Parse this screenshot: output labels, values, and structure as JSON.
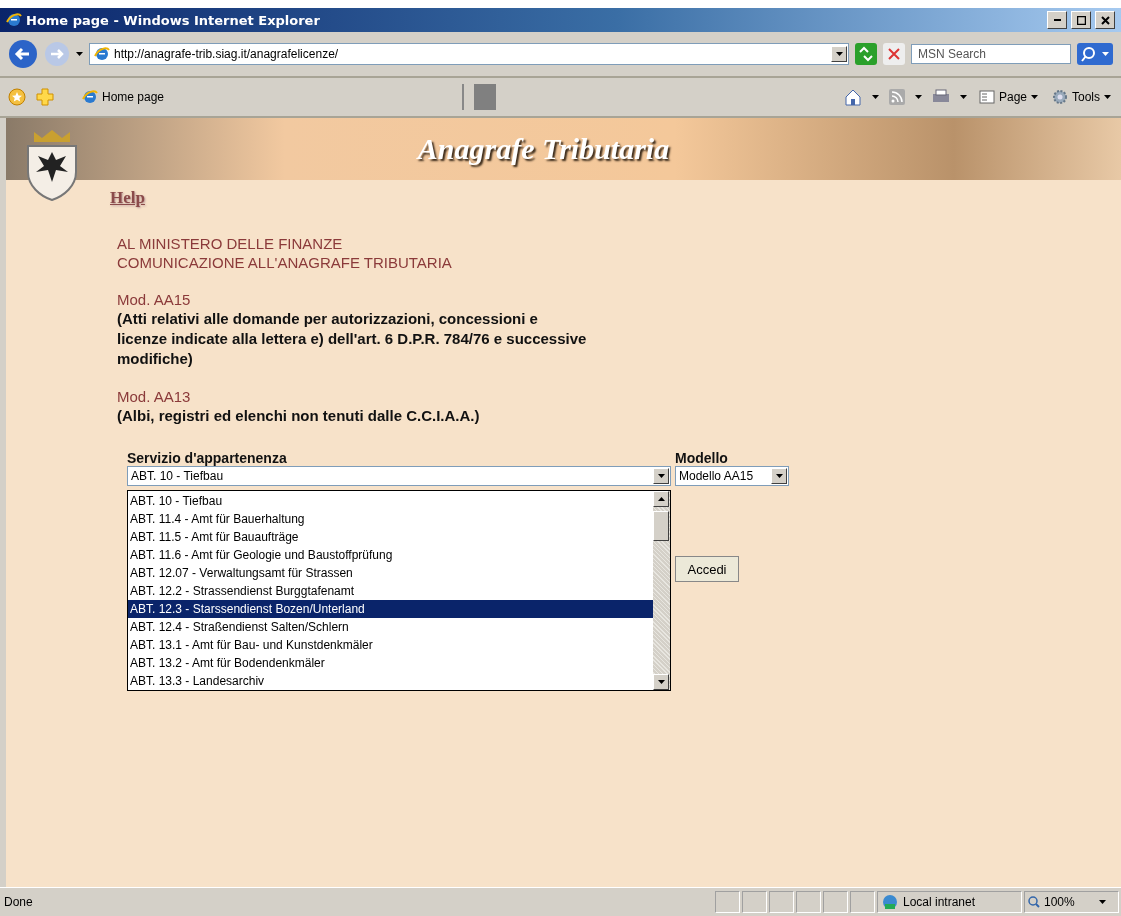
{
  "window": {
    "title": "Home page - Windows Internet Explorer"
  },
  "address_bar": {
    "url": "http://anagrafe-trib.siag.it/anagrafelicenze/"
  },
  "search": {
    "placeholder": "MSN Search"
  },
  "tab": {
    "label": "Home page"
  },
  "command_bar": [
    {
      "label": "Page",
      "kind": "page"
    },
    {
      "label": "Tools",
      "kind": "tools"
    }
  ],
  "page": {
    "banner_title": "Anagrafe Tributaria",
    "help_link": "Help",
    "heading": [
      "AL MINISTERO DELLE FINANZE",
      "COMUNICAZIONE ALL'ANAGRAFE TRIBUTARIA"
    ],
    "sections": [
      {
        "title": "Mod. AA15",
        "description": "(Atti relativi alle domande per autorizzazioni, concessioni e licenze indicate alla lettera e) dell'art. 6 D.P.R. 784/76 e successive modifiche)"
      },
      {
        "title": "Mod. AA13",
        "description": "(Albi, registri ed elenchi non tenuti dalle C.C.I.A.A.)"
      }
    ],
    "form": {
      "service_label": "Servizio d'appartenenza",
      "service_value": "ABT. 10 - Tiefbau",
      "service_options": [
        {
          "label": "ABT. 10 - Tiefbau",
          "selected": false
        },
        {
          "label": "ABT. 11.4 - Amt für Bauerhaltung",
          "selected": false
        },
        {
          "label": "ABT. 11.5 - Amt für Bauaufträge",
          "selected": false
        },
        {
          "label": "ABT. 11.6 - Amt für Geologie und Baustoffprüfung",
          "selected": false
        },
        {
          "label": "ABT. 12.07 - Verwaltungsamt für Strassen",
          "selected": false
        },
        {
          "label": "ABT. 12.2 - Strassendienst Burggtafenamt",
          "selected": false
        },
        {
          "label": "ABT. 12.3 - Starssendienst Bozen/Unterland",
          "selected": true
        },
        {
          "label": "ABT. 12.4 - Straßendienst Salten/Schlern",
          "selected": false
        },
        {
          "label": "ABT. 13.1 - Amt für Bau- und Kunstdenkmäler",
          "selected": false
        },
        {
          "label": "ABT. 13.2 - Amt für Bodendenkmäler",
          "selected": false
        },
        {
          "label": "ABT. 13.3 - Landesarchiv",
          "selected": false
        }
      ],
      "model_label": "Modello",
      "model_value": "Modello AA15",
      "submit": "Accedi"
    }
  },
  "status_bar": {
    "text": "Done",
    "zone": "Local intranet",
    "zoom": "100%"
  }
}
